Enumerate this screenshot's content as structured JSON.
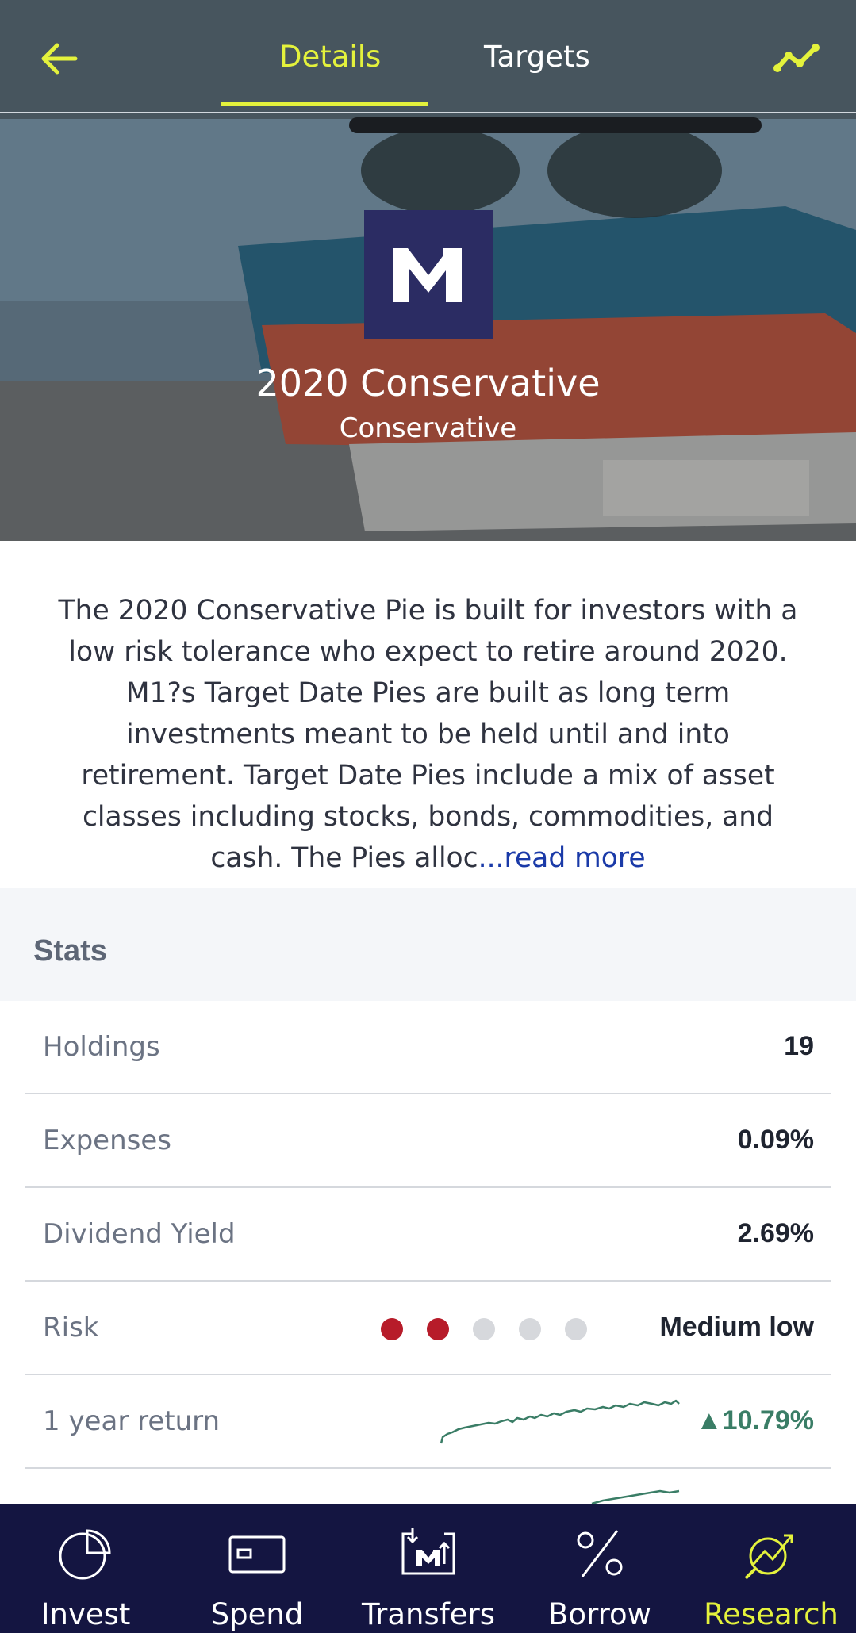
{
  "header": {
    "tabs": [
      {
        "label": "Details",
        "active": true
      },
      {
        "label": "Targets",
        "active": false
      }
    ],
    "back_icon": "arrow-left-icon",
    "chart_icon": "trend-line-icon",
    "accent_color": "#e4f23c"
  },
  "pie": {
    "logo_text": "M1",
    "title": "2020 Conservative",
    "subtitle": "Conservative",
    "description": "The 2020 Conservative Pie is built for investors with a low risk tolerance who expect to retire around 2020. M1?s Target Date Pies are built as long term investments meant to be held until and into retirement. Target Date Pies include a mix of asset classes including stocks, bonds, commodities, and cash. The Pies alloc",
    "read_more": "...read more"
  },
  "stats": {
    "title": "Stats",
    "holdings": {
      "label": "Holdings",
      "value": "19"
    },
    "expenses": {
      "label": "Expenses",
      "value": "0.09%"
    },
    "dividend_yield": {
      "label": "Dividend Yield",
      "value": "2.69%"
    },
    "risk": {
      "label": "Risk",
      "value": "Medium low",
      "level": 2,
      "max_level": 5,
      "active_color": "#b71c2a"
    },
    "one_year_return": {
      "label": "1 year return",
      "value": "▲10.79%",
      "trend_color": "#3a7d66"
    }
  },
  "bottom_nav": [
    {
      "label": "Invest",
      "icon": "pie-chart-icon",
      "active": false
    },
    {
      "label": "Spend",
      "icon": "card-icon",
      "active": false
    },
    {
      "label": "Transfers",
      "icon": "transfer-icon",
      "active": false
    },
    {
      "label": "Borrow",
      "icon": "percent-icon",
      "active": false
    },
    {
      "label": "Research",
      "icon": "research-chart-icon",
      "active": true
    }
  ]
}
